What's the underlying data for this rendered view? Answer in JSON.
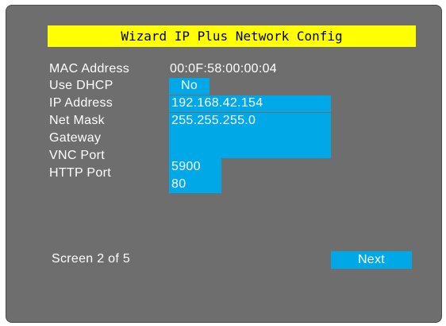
{
  "title": "Wizard IP Plus Network Config",
  "fields": {
    "mac": {
      "label": "MAC Address",
      "value": "00:0F:58:00:00:04"
    },
    "dhcp": {
      "label": "Use DHCP",
      "value": "No"
    },
    "ip": {
      "label": "IP Address",
      "value": "192.168.42.154"
    },
    "netmask": {
      "label": "Net Mask",
      "value": "255.255.255.0"
    },
    "gateway": {
      "label": "Gateway",
      "value": ""
    },
    "vnc_port": {
      "label": "VNC Port",
      "value": "5900"
    },
    "http_port": {
      "label": "HTTP Port",
      "value": "80"
    }
  },
  "footer": {
    "screen_indicator": "Screen 2 of 5",
    "next_label": "Next"
  },
  "colors": {
    "background": "#6e6e6e",
    "title_bar": "#ffff00",
    "field_highlight": "#00a8e8"
  }
}
